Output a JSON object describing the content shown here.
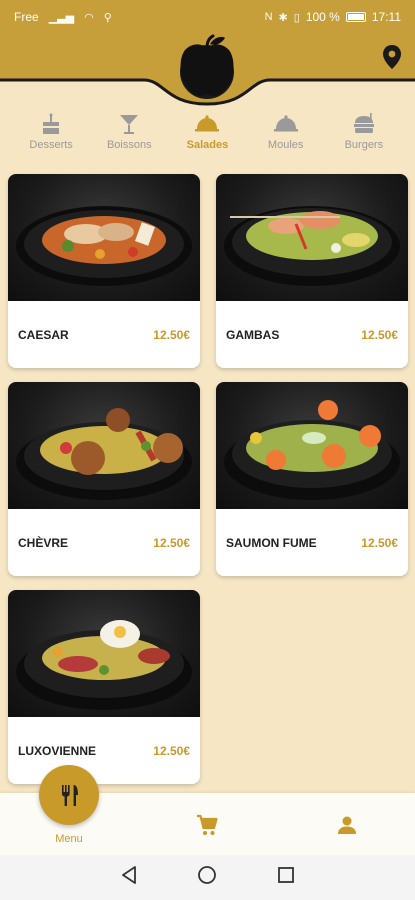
{
  "status_bar": {
    "carrier": "Free",
    "battery": "100 %",
    "time": "17:11"
  },
  "categories": [
    {
      "label": "Desserts",
      "icon": "cake-icon",
      "active": false
    },
    {
      "label": "Boissons",
      "icon": "cocktail-icon",
      "active": false
    },
    {
      "label": "Salades",
      "icon": "cloche-icon",
      "active": true
    },
    {
      "label": "Moules",
      "icon": "cloche-icon",
      "active": false
    },
    {
      "label": "Burgers",
      "icon": "burger-icon",
      "active": false
    }
  ],
  "products": [
    {
      "name": "CAESAR",
      "price": "12.50€"
    },
    {
      "name": "GAMBAS",
      "price": "12.50€"
    },
    {
      "name": "CHÈVRE",
      "price": "12.50€"
    },
    {
      "name": "SAUMON FUME",
      "price": "12.50€"
    },
    {
      "name": "LUXOVIENNE",
      "price": "12.50€"
    }
  ],
  "bottom_nav": {
    "menu_label": "Menu"
  },
  "colors": {
    "accent": "#c79a2a",
    "header": "#c69f3a",
    "background": "#f6e6c4"
  }
}
